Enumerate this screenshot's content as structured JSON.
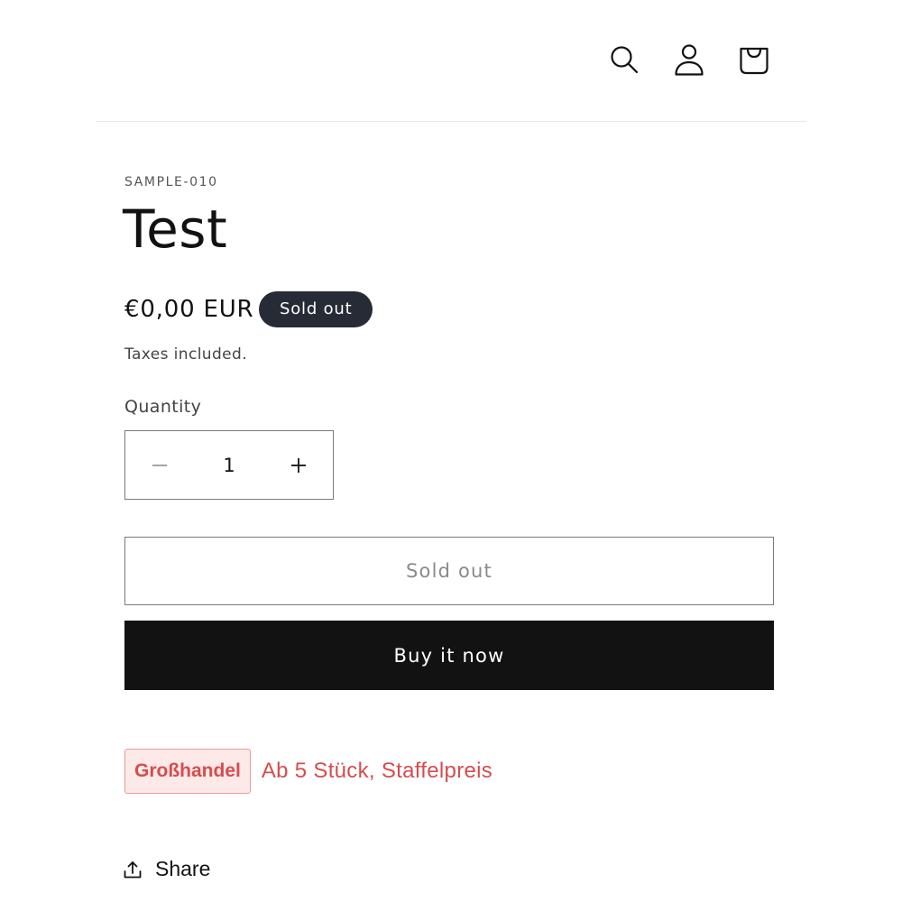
{
  "header": {
    "icons": [
      "search-icon",
      "account-icon",
      "cart-icon"
    ]
  },
  "product": {
    "sku": "SAMPLE-010",
    "title": "Test",
    "price": "€0,00 EUR",
    "badge": "Sold out",
    "taxes_note": "Taxes included."
  },
  "quantity": {
    "label": "Quantity",
    "value": "1",
    "minus_symbol": "−",
    "plus_symbol": "+"
  },
  "buttons": {
    "sold_out_label": "Sold out",
    "buy_now_label": "Buy it now"
  },
  "wholesale": {
    "tag": "Großhandel",
    "text": "Ab 5 Stück, Staffelpreis"
  },
  "share": {
    "label": "Share"
  },
  "colors": {
    "badge_bg": "#262b36",
    "buy_button_bg": "#121212",
    "wholesale_accent": "#d64d4d",
    "wholesale_tag_bg": "#fde9e8"
  }
}
